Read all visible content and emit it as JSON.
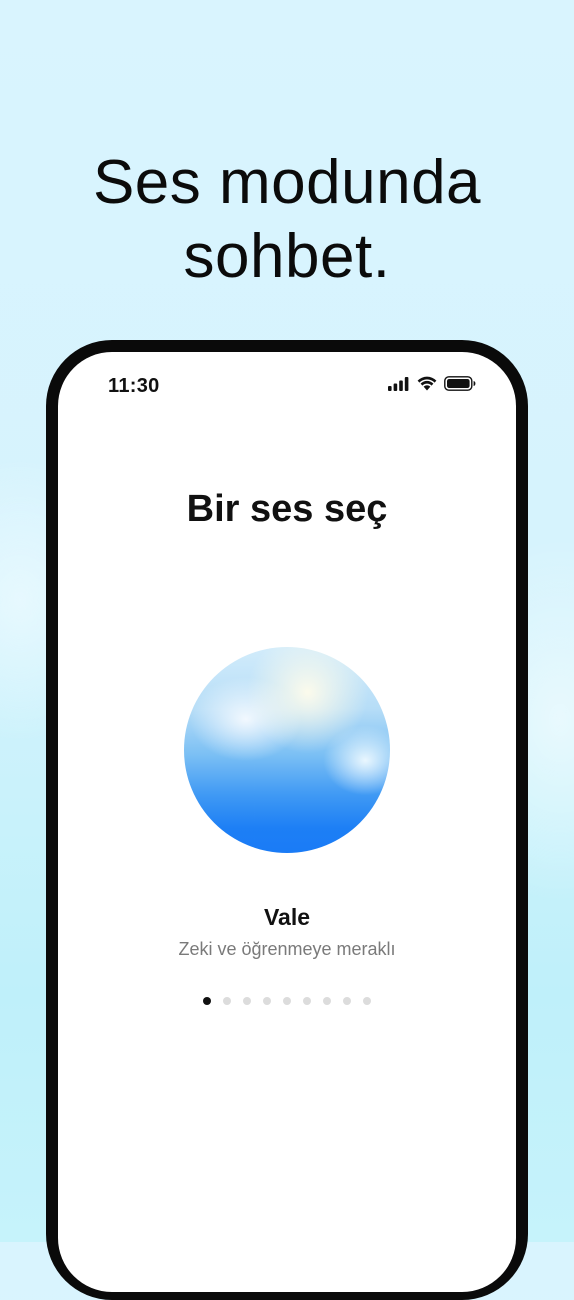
{
  "headline": {
    "line1": "Ses modunda",
    "line2": "sohbet."
  },
  "status_bar": {
    "time": "11:30",
    "icons": [
      "cellular-signal-icon",
      "wifi-icon",
      "battery-icon"
    ]
  },
  "screen": {
    "title": "Bir ses seç",
    "voice": {
      "name": "Vale",
      "description": "Zeki ve öğrenmeye meraklı"
    },
    "pager": {
      "total": 9,
      "active_index": 0
    }
  },
  "colors": {
    "background_top": "#d9f4fe",
    "background_bottom": "#c6f3fb",
    "phone_frame": "#0a0a0a",
    "orb_blue": "#1a7bf6",
    "text_primary": "#111111",
    "text_secondary": "#7a7a7a"
  }
}
